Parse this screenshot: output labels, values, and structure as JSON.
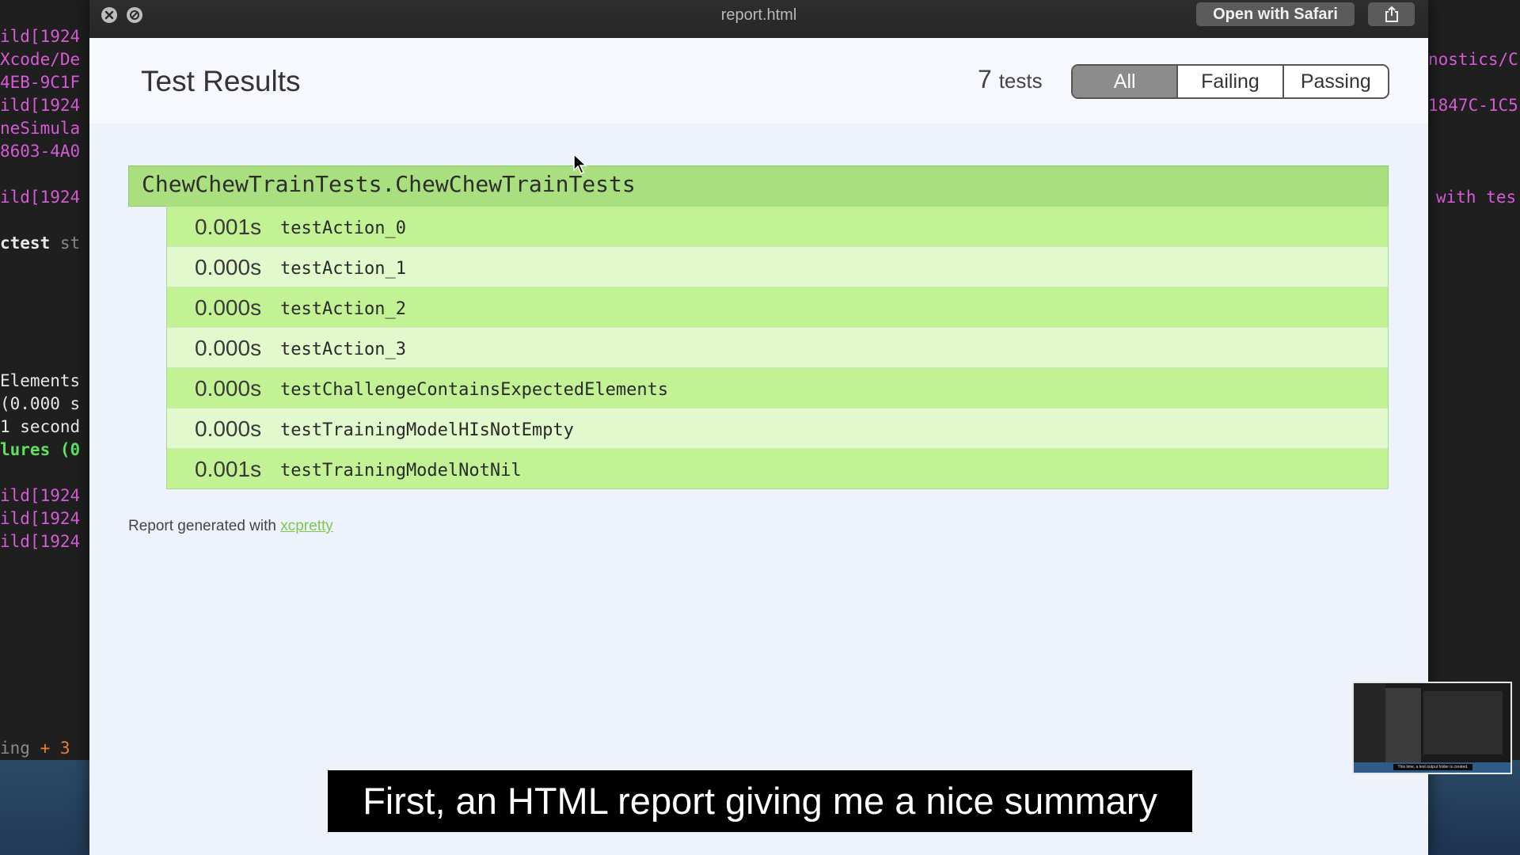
{
  "window": {
    "title": "report.html",
    "open_with_label": "Open with Safari"
  },
  "report": {
    "title": "Test Results",
    "count_number": "7",
    "count_word": "tests",
    "filters": [
      "All",
      "Failing",
      "Passing"
    ],
    "active_filter": "All",
    "suite": "ChewChewTrainTests.ChewChewTrainTests",
    "tests": [
      {
        "time": "0.001s",
        "name": "testAction_0"
      },
      {
        "time": "0.000s",
        "name": "testAction_1"
      },
      {
        "time": "0.000s",
        "name": "testAction_2"
      },
      {
        "time": "0.000s",
        "name": "testAction_3"
      },
      {
        "time": "0.000s",
        "name": "testChallengeContainsExpectedElements"
      },
      {
        "time": "0.000s",
        "name": "testTrainingModelHIsNotEmpty"
      },
      {
        "time": "0.001s",
        "name": "testTrainingModelNotNil"
      }
    ],
    "footer_text": "Report generated with ",
    "footer_link": "xcpretty"
  },
  "terminal_left": [
    "ild[1924",
    "Xcode/De",
    "4EB-9C1F",
    "ild[1924",
    "neSimula",
    "8603-4A0",
    "ild[1924",
    "ctest",
    "st",
    "Elements",
    "(0.000 s",
    "1 second",
    "lures (0",
    "ild[1924",
    "ild[1924",
    "ild[1924",
    "ing",
    "3"
  ],
  "terminal_right": [
    "nostics/C",
    "1847C-1C5",
    "with tes"
  ],
  "thumbnail_caption": "This time, a test output folder is created.",
  "subtitle": "First, an HTML report giving me a nice summary",
  "colors": {
    "suite_green": "#a9df7e",
    "row_green_dark": "#c2f294",
    "row_green_light": "#e2f9cd",
    "terminal_magenta": "#d65bd6",
    "link_green": "#7bc84f"
  }
}
